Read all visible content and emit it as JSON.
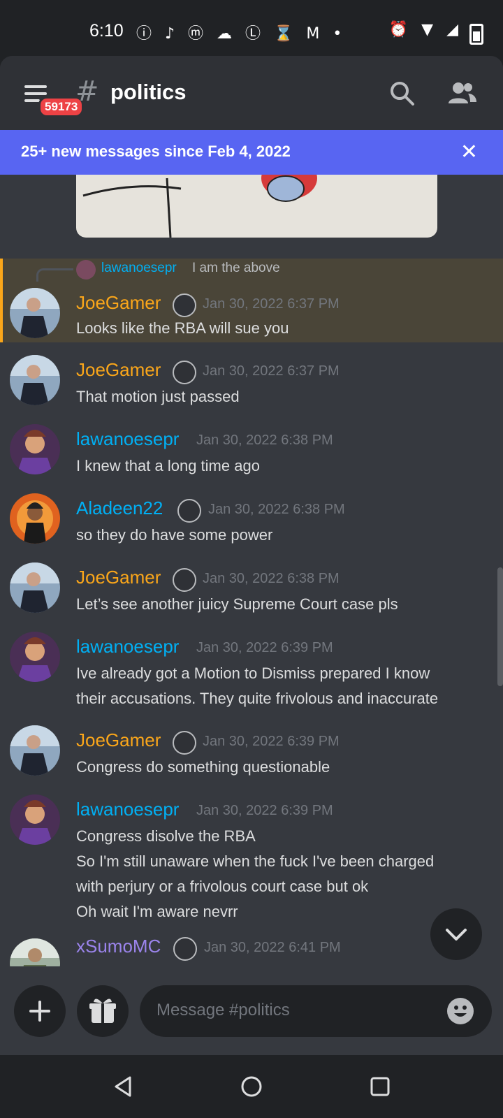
{
  "status_bar": {
    "time": "6:10",
    "left_icons": "ⓘ ♪ ⓜ ☁ Ⓛ ⌛ M •",
    "right_icons": "⏰ ▼ ◢"
  },
  "header": {
    "unread_badge": "59173",
    "hash": "#",
    "channel_name": "politics"
  },
  "banner": {
    "text": "25+ new messages since Feb 4, 2022",
    "close": "✕"
  },
  "reply_preview": {
    "author": "lawanoesepr",
    "text": "I am the above"
  },
  "messages": [
    {
      "author": "JoeGamer",
      "timestamp": "Jan 30, 2022 6:37 PM",
      "lines": [
        "Looks like the RBA will sue you"
      ]
    },
    {
      "author": "JoeGamer",
      "timestamp": "Jan 30, 2022 6:37 PM",
      "lines": [
        "That motion just passed"
      ]
    },
    {
      "author": "lawanoesepr",
      "timestamp": "Jan 30, 2022 6:38 PM",
      "lines": [
        "I knew that a long time ago"
      ]
    },
    {
      "author": "Aladeen22",
      "timestamp": "Jan 30, 2022 6:38 PM",
      "lines": [
        "so they do have some power"
      ]
    },
    {
      "author": "JoeGamer",
      "timestamp": "Jan 30, 2022 6:38 PM",
      "lines": [
        "Let’s see another juicy Supreme Court case pls"
      ]
    },
    {
      "author": "lawanoesepr",
      "timestamp": "Jan 30, 2022 6:39 PM",
      "lines": [
        "Ive already got a Motion to Dismiss prepared I know",
        "their accusations. They quite frivolous and inaccurate"
      ]
    },
    {
      "author": "JoeGamer",
      "timestamp": "Jan 30, 2022 6:39 PM",
      "lines": [
        "Congress do something questionable"
      ]
    },
    {
      "author": "lawanoesepr",
      "timestamp": "Jan 30, 2022 6:39 PM",
      "lines": [
        "Congress disolve the RBA",
        "So I'm still unaware when the fuck I've been charged",
        "with perjury or a frivolous court case but ok",
        "Oh wait I'm aware nevrr"
      ]
    },
    {
      "author": "xSumoMC",
      "timestamp": "Jan 30, 2022 6:41 PM",
      "lines": []
    }
  ],
  "composer": {
    "placeholder": "Message #politics"
  },
  "colors": {
    "joegamer": "#faa61a",
    "lawanoesepr": "#00b0f4",
    "aladeen22": "#00b0f4",
    "xsumomc": "#9b84ec",
    "banner": "#5865f2",
    "badge": "#ed4245"
  },
  "icons": {
    "menu": "hamburger-icon",
    "search": "search-icon",
    "members": "members-icon",
    "add": "plus-icon",
    "gift": "gift-icon",
    "emoji": "emoji-icon",
    "jump": "chevron-down-icon"
  }
}
